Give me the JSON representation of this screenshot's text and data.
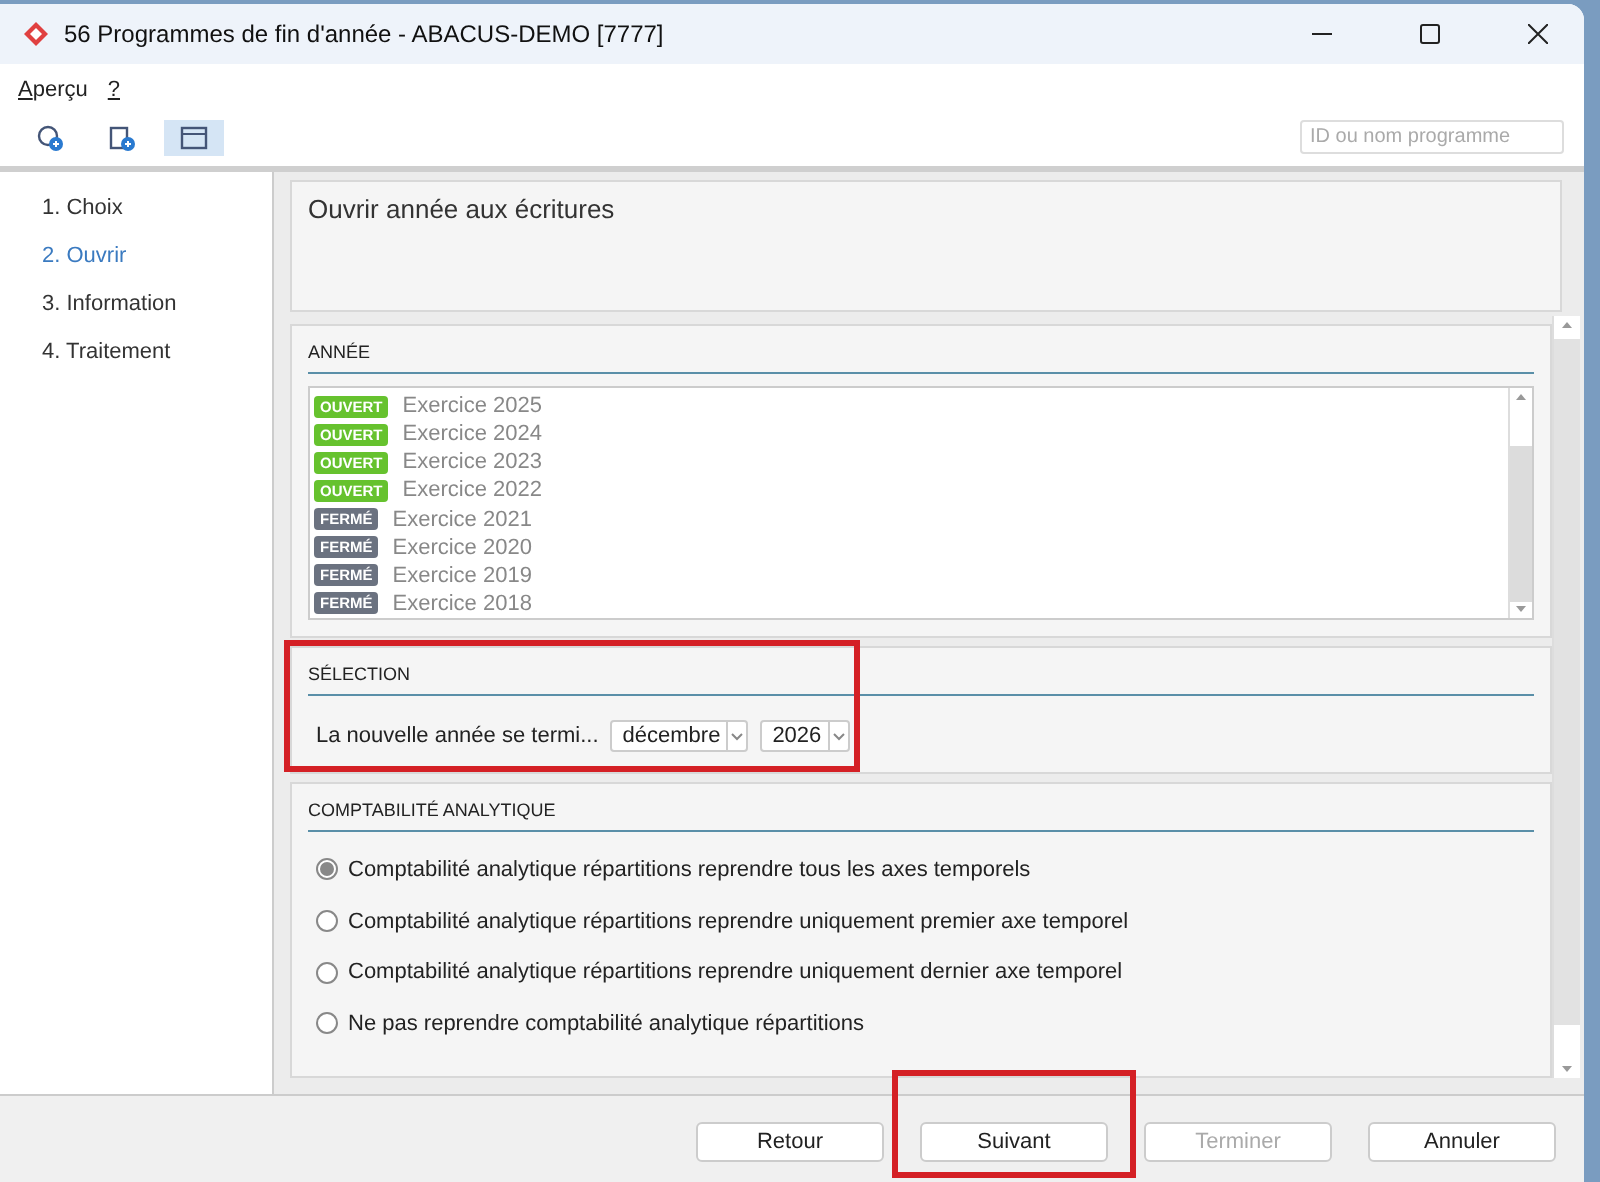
{
  "window": {
    "title": "56 Programmes de fin d'année - ABACUS-DEMO [7777]"
  },
  "menu": [
    {
      "accel": "A",
      "rest": "perçu"
    },
    {
      "accel": "?"
    }
  ],
  "toolbar": [
    {
      "kind": "refresh",
      "selected": false
    },
    {
      "kind": "clipboard",
      "selected": false
    },
    {
      "kind": "window",
      "selected": true
    }
  ],
  "search": {
    "placeholder": "ID ou nom programme"
  },
  "steps": [
    {
      "label": "1. Choix",
      "selected": false
    },
    {
      "label": "2. Ouvrir",
      "selected": true
    },
    {
      "label": "3. Information",
      "selected": false
    },
    {
      "label": "4. Traitement",
      "selected": false
    }
  ],
  "header": {
    "title": "Ouvrir année aux écritures"
  },
  "year_panel": {
    "title": "ANNÉE",
    "items": [
      {
        "kind": "open",
        "badge": "OUVERT",
        "label": "Exercice 2025"
      },
      {
        "kind": "open",
        "badge": "OUVERT",
        "label": "Exercice 2024"
      },
      {
        "kind": "open",
        "badge": "OUVERT",
        "label": "Exercice 2023"
      },
      {
        "kind": "open",
        "badge": "OUVERT",
        "label": "Exercice 2022"
      },
      {
        "kind": "closed",
        "badge": "FERMÉ",
        "label": "Exercice 2021"
      },
      {
        "kind": "closed",
        "badge": "FERMÉ",
        "label": "Exercice 2020"
      },
      {
        "kind": "closed",
        "badge": "FERMÉ",
        "label": "Exercice 2019"
      },
      {
        "kind": "closed",
        "badge": "FERMÉ",
        "label": "Exercice 2018"
      }
    ]
  },
  "selection_panel": {
    "title": "SÉLECTION",
    "highlighted": true,
    "label": "La nouvelle année se termi...",
    "month": "décembre",
    "year": "2026"
  },
  "analytics_panel": {
    "title": "COMPTABILITÉ ANALYTIQUE",
    "options": [
      {
        "label": "Comptabilité analytique répartitions reprendre tous les axes temporels",
        "selected": true
      },
      {
        "label": "Comptabilité analytique répartitions reprendre uniquement premier axe temporel",
        "selected": false
      },
      {
        "label": "Comptabilité analytique répartitions reprendre uniquement dernier axe temporel",
        "selected": false
      },
      {
        "label": "Ne pas reprendre comptabilité analytique répartitions",
        "selected": false
      }
    ]
  },
  "buttons": [
    {
      "label": "Retour",
      "disabled": false,
      "highlighted": false
    },
    {
      "label": "Suivant",
      "disabled": false,
      "highlighted": true
    },
    {
      "label": "Terminer",
      "disabled": true,
      "highlighted": false
    },
    {
      "label": "Annuler",
      "disabled": false,
      "highlighted": false
    }
  ]
}
